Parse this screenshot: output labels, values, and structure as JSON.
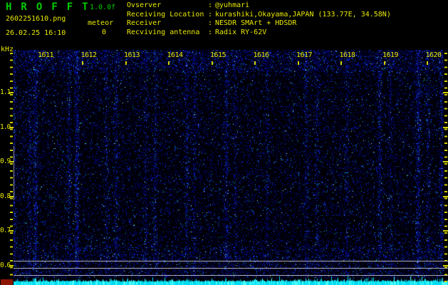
{
  "titlebar": {
    "app_title": "HROFFT",
    "version": "1.0.0f",
    "filename": "2602251610.png",
    "datetime": "26.02.25 16:10",
    "meteor_label": "meteor",
    "meteor_count": "0"
  },
  "info": {
    "separator": ":",
    "rows": [
      {
        "label": "Ovserver",
        "value": "@yuhmari"
      },
      {
        "label": "Receiving Location",
        "value": "kurashiki,Okayama,JAPAN (133.77E, 34.58N)"
      },
      {
        "label": "Receiver",
        "value": "NESDR SMArt + HDSDR"
      },
      {
        "label": "Recviving antenna",
        "value": "Radix RY-62V"
      }
    ]
  },
  "spectrogram": {
    "freq_axis": {
      "unit": "kHz",
      "labels": [
        "1.1",
        "1.0",
        "0.9",
        "0.8",
        "0.7",
        "0.6"
      ]
    },
    "time_axis": {
      "labels": [
        "1611",
        "1612",
        "1613",
        "1614",
        "1615",
        "1616",
        "1617",
        "1618",
        "1619",
        "1620"
      ]
    },
    "colors": {
      "text_yellow": "#e8e800",
      "title_green": "#00cc00",
      "noise_background": "#000004",
      "signal_cyan": "#00dcf2",
      "signal_cyan_bright": "#49ffff",
      "marker_red": "#8c1500",
      "grid_gray": "#c8cad6"
    }
  }
}
